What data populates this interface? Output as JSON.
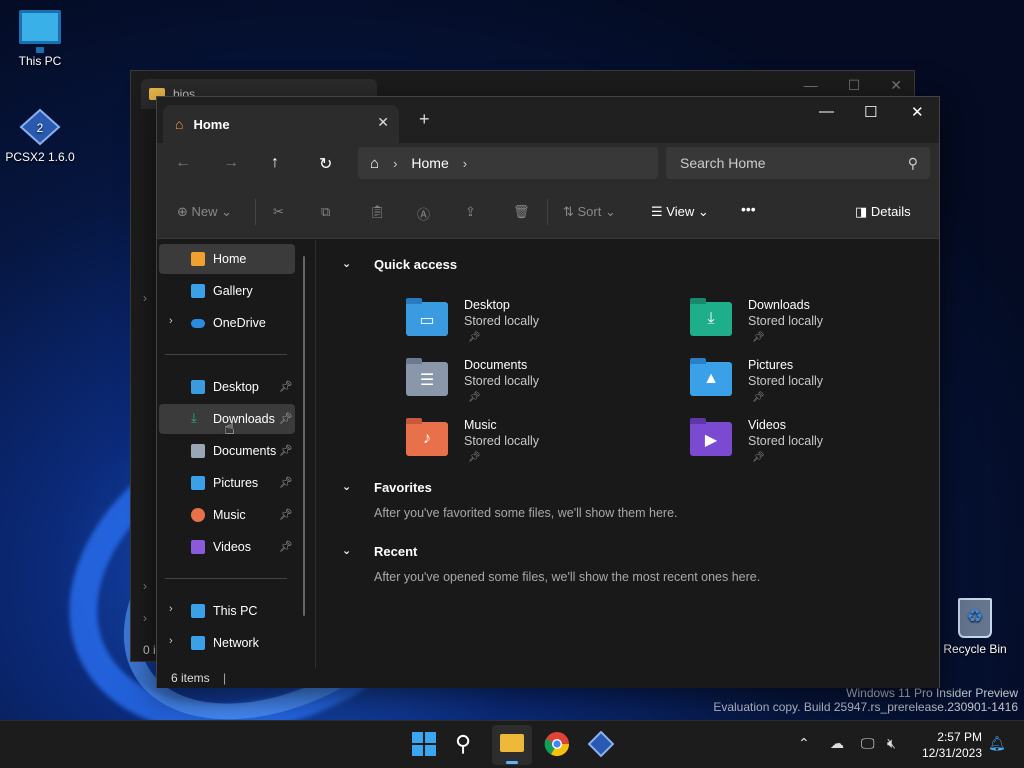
{
  "desktop": {
    "icons": [
      {
        "label": "This PC",
        "icon": "monitor-icon"
      },
      {
        "label": "PCSX2 1.6.0",
        "icon": "pcsx2-icon"
      },
      {
        "label": "Recycle Bin",
        "icon": "recycle-bin-icon"
      }
    ],
    "watermark_line1": "Windows 11 Pro Insider Preview",
    "watermark_line2": "Evaluation copy. Build 25947.rs_prerelease.230901-1416"
  },
  "back_window": {
    "tab_title": "bios",
    "status_fragment": "0 i"
  },
  "window": {
    "tab_title": "Home",
    "tab_close": "✕",
    "new_tab": "+",
    "controls": {
      "minimize": "—",
      "maximize": "☐",
      "close": "✕"
    }
  },
  "navbar": {
    "back": "←",
    "forward": "→",
    "up": "↑",
    "refresh": "↻",
    "breadcrumb": [
      "Home"
    ],
    "search_placeholder": "Search Home"
  },
  "commandbar": {
    "new_label": "New",
    "sort_label": "Sort",
    "view_label": "View",
    "more_label": "•••",
    "details_label": "Details"
  },
  "sidebar": {
    "top": [
      {
        "label": "Home",
        "icon": "home-icon",
        "color": "#f0a030"
      },
      {
        "label": "Gallery",
        "icon": "gallery-icon",
        "color": "#3aa0e8"
      },
      {
        "label": "OneDrive",
        "icon": "onedrive-icon",
        "color": "#2a8ce0"
      }
    ],
    "pinned": [
      {
        "label": "Desktop",
        "icon": "desktop-folder-icon",
        "color": "#3a9be0"
      },
      {
        "label": "Downloads",
        "icon": "download-icon",
        "color": "#27b08a"
      },
      {
        "label": "Documents",
        "icon": "documents-icon",
        "color": "#9aa5b5"
      },
      {
        "label": "Pictures",
        "icon": "pictures-icon",
        "color": "#3aa0e8"
      },
      {
        "label": "Music",
        "icon": "music-icon",
        "color": "#e8704a"
      },
      {
        "label": "Videos",
        "icon": "videos-icon",
        "color": "#8a5ad8"
      }
    ],
    "bottom": [
      {
        "label": "This PC",
        "icon": "this-pc-icon",
        "color": "#3aa0e8"
      },
      {
        "label": "Network",
        "icon": "network-icon",
        "color": "#3aa0e8"
      }
    ]
  },
  "content": {
    "quick_access_title": "Quick access",
    "quick_access": [
      {
        "name": "Desktop",
        "sub": "Stored locally",
        "icon": "desktop-folder-icon",
        "color": "#3a9be0",
        "glyph": "▭"
      },
      {
        "name": "Downloads",
        "sub": "Stored locally",
        "icon": "downloads-folder-icon",
        "color": "#1fae8a",
        "glyph": "⤓"
      },
      {
        "name": "Documents",
        "sub": "Stored locally",
        "icon": "documents-folder-icon",
        "color": "#8a97aa",
        "glyph": "☰"
      },
      {
        "name": "Pictures",
        "sub": "Stored locally",
        "icon": "pictures-folder-icon",
        "color": "#3aa0e8",
        "glyph": "▲"
      },
      {
        "name": "Music",
        "sub": "Stored locally",
        "icon": "music-folder-icon",
        "color": "#e8704a",
        "glyph": "♪"
      },
      {
        "name": "Videos",
        "sub": "Stored locally",
        "icon": "videos-folder-icon",
        "color": "#7a4ad0",
        "glyph": "▶"
      }
    ],
    "favorites_title": "Favorites",
    "favorites_note": "After you've favorited some files, we'll show them here.",
    "recent_title": "Recent",
    "recent_note": "After you've opened some files, we'll show the most recent ones here."
  },
  "status": {
    "count": "6 items"
  },
  "taskbar": {
    "time": "2:57 PM",
    "date": "12/31/2023"
  }
}
